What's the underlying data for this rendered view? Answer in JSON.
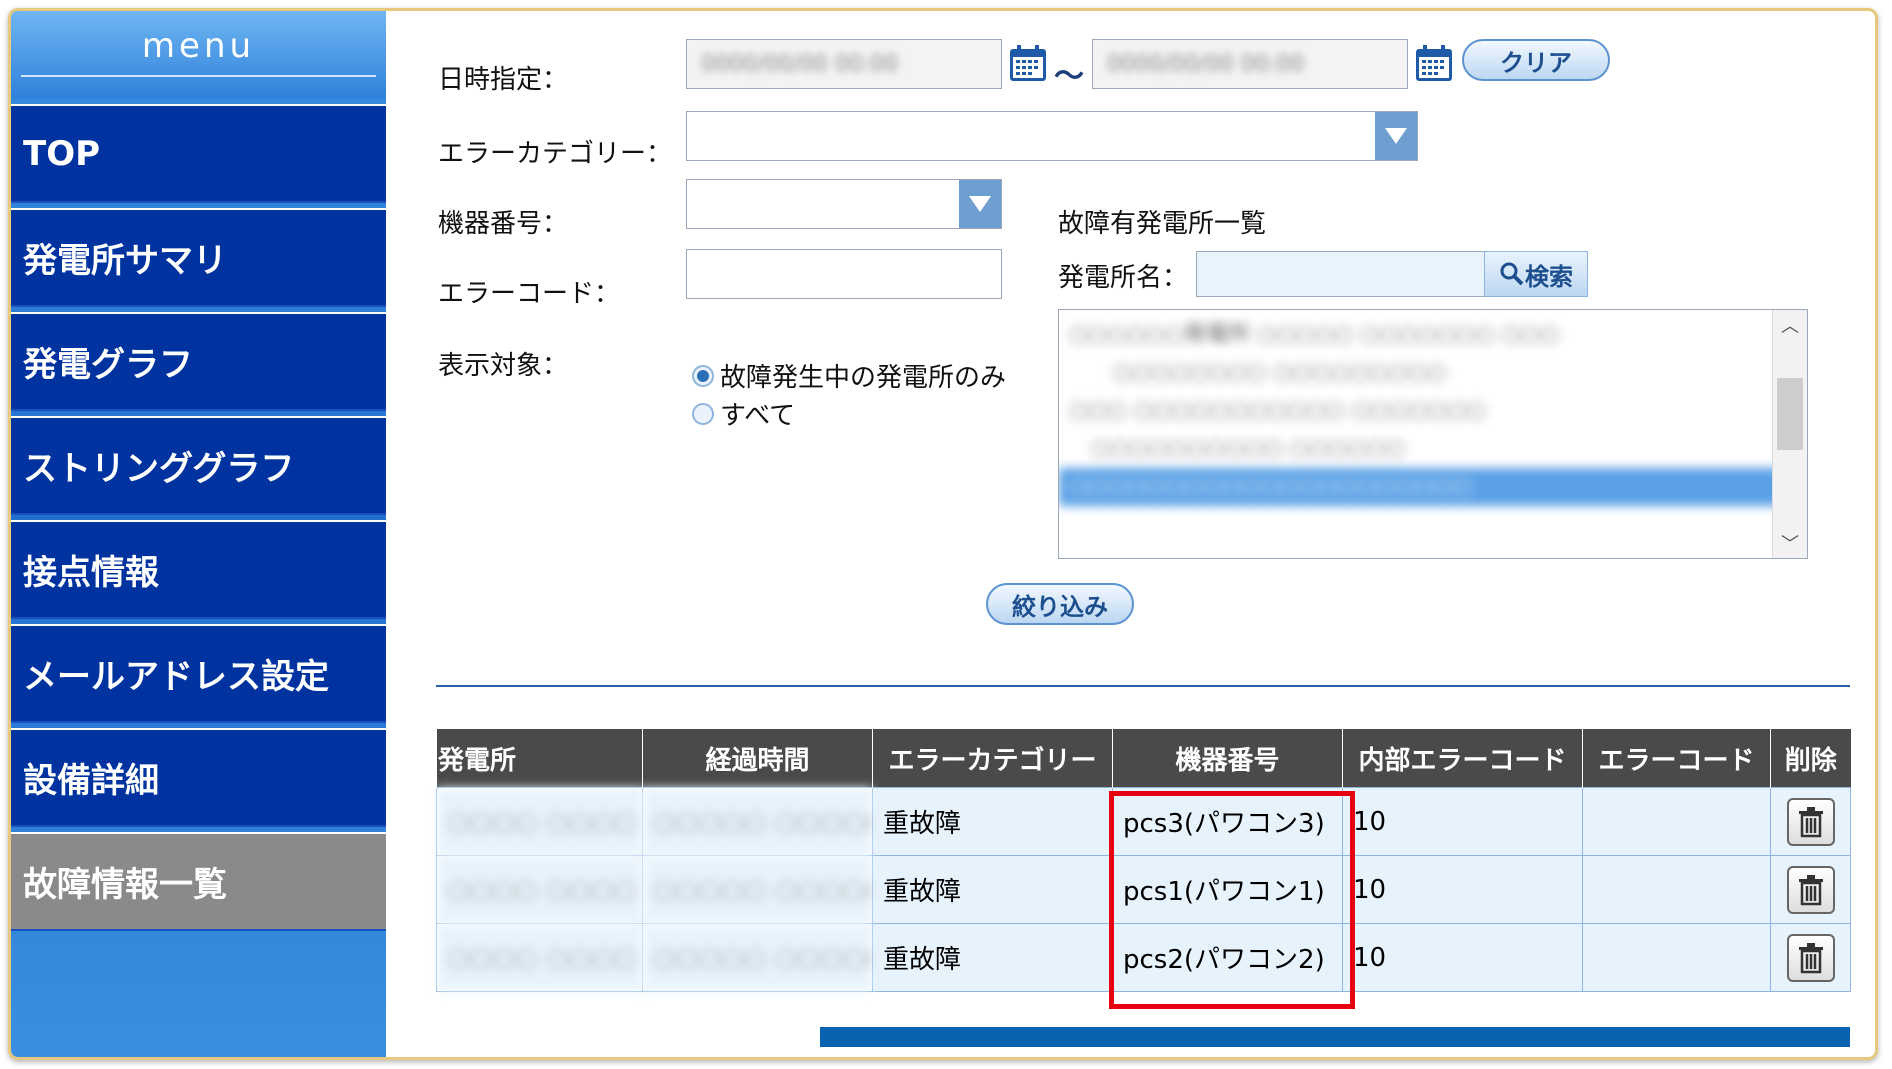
{
  "sidebar": {
    "header": "menu",
    "items": [
      {
        "label": "TOP"
      },
      {
        "label": "発電所サマリ"
      },
      {
        "label": "発電グラフ"
      },
      {
        "label": "ストリンググラフ"
      },
      {
        "label": "接点情報"
      },
      {
        "label": "メールアドレス設定"
      },
      {
        "label": "設備詳細"
      },
      {
        "label": "故障情報一覧",
        "active": true
      }
    ]
  },
  "filters": {
    "date_label": "日時指定：",
    "date_separator": "～",
    "clear_label": "クリア",
    "category_label": "エラーカテゴリー：",
    "device_label": "機器番号：",
    "error_code_label": "エラーコード：",
    "display_label": "表示対象：",
    "display_options": [
      "故障発生中の発電所のみ",
      "すべて"
    ],
    "display_selected": 0,
    "fault_list_label": "故障有発電所一覧",
    "plant_name_label": "発電所名：",
    "search_label": "検索",
    "narrow_label": "絞り込み"
  },
  "table": {
    "headers": [
      "発電所",
      "経過時間",
      "エラーカテゴリー",
      "機器番号",
      "内部エラーコード",
      "エラーコード",
      "削除"
    ],
    "rows": [
      {
        "category": "重故障",
        "device": "pcs3(パワコン3)",
        "internal_code": "10",
        "error_code": ""
      },
      {
        "category": "重故障",
        "device": "pcs1(パワコン1)",
        "internal_code": "10",
        "error_code": ""
      },
      {
        "category": "重故障",
        "device": "pcs2(パワコン2)",
        "internal_code": "10",
        "error_code": ""
      }
    ]
  },
  "colors": {
    "nav_bg": "#0033a0",
    "nav_active": "#8a8a8a",
    "highlight": "#e60012"
  }
}
